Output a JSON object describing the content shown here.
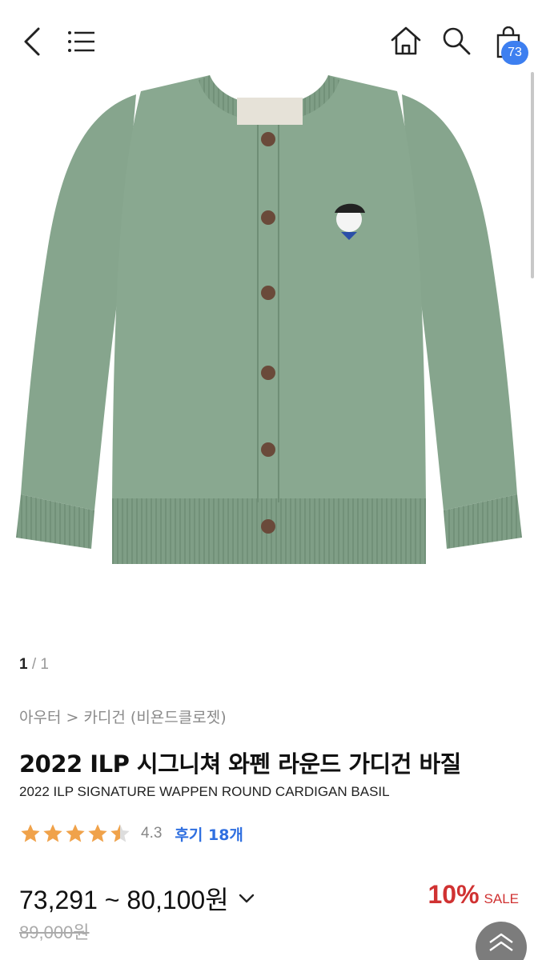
{
  "header": {
    "back_icon": "chevron-left-icon",
    "menu_icon": "hamburger-menu-icon",
    "home_icon": "home-icon",
    "search_icon": "search-icon",
    "cart_icon": "shopping-bag-icon",
    "cart_count": "73",
    "badge_color": "#3d7ff0"
  },
  "gallery": {
    "image": "green-knit-cardigan-product-photo",
    "current": "1",
    "separator": "/",
    "total": "1"
  },
  "product": {
    "breadcrumb": "아우터 > 카디건 (비욘드클로젯)",
    "title_ko": "2022 ILP 시그니쳐 와펜 라운드 가디건 바질",
    "title_en": "2022 ILP SIGNATURE WAPPEN ROUND CARDIGAN BASIL",
    "rating": 4.3,
    "rating_text": "4.3",
    "review_label": "후기 18개",
    "price_range": "73,291 ~ 80,100원",
    "discount_pct": "10%",
    "sale_label": "SALE",
    "original_price": "89,000원",
    "star_color": "#f0a24a",
    "accent_color": "#2f6fe0",
    "sale_color": "#d03232"
  },
  "scroll_top_icon": "double-chevron-up-icon"
}
